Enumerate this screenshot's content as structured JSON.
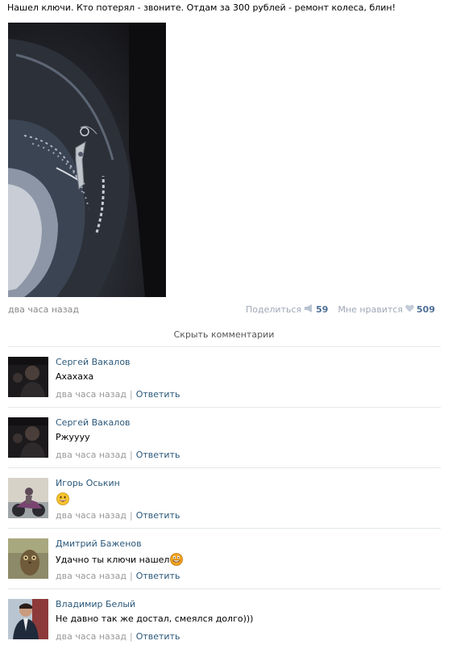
{
  "post": {
    "text": "Нашел ключи. Кто потерял - звоните. Отдам за 300 рублей - ремонт колеса, блин!",
    "time": "два часа назад",
    "share_label": "Поделиться",
    "share_count": "59",
    "like_label": "Мне нравится",
    "like_count": "509"
  },
  "hide_comments_label": "Скрыть комментарии",
  "comments": [
    {
      "author": "Сергей Вакалов",
      "text": "Ахахаха",
      "time": "два часа назад",
      "reply": "Ответить"
    },
    {
      "author": "Сергей Вакалов",
      "text": "Ржуууу",
      "time": "два часа назад",
      "reply": "Ответить"
    },
    {
      "author": "Игорь Оськин",
      "text": "",
      "time": "два часа назад",
      "reply": "Ответить"
    },
    {
      "author": "Дмитрий Баженов",
      "text": "Удачно ты ключи нашел",
      "time": "два часа назад",
      "reply": "Ответить"
    },
    {
      "author": "Владимир Белый",
      "text": "Не давно так же достал, смеялся долго)))",
      "time": "два часа назад",
      "reply": "Ответить"
    }
  ],
  "icons": {
    "share": "megaphone-icon",
    "like": "heart-icon",
    "smile": "smile-emoji-icon",
    "grin": "grin-emoji-icon"
  },
  "colors": {
    "link": "#2b587a",
    "count": "#4f6f96",
    "muted": "#888888",
    "separator": "#e4e7eb"
  }
}
